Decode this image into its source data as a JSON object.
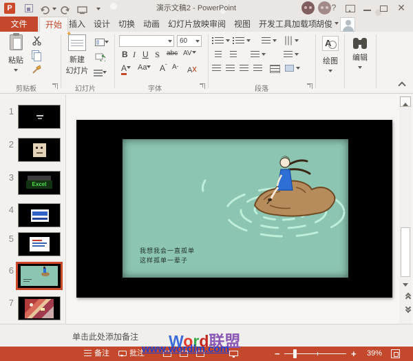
{
  "colors": {
    "accent_red": "#c4482b",
    "active_tab_text": "#c4482b",
    "slide_teal": "#8cc5b2",
    "selected_thumb_border": "#cb4a2b",
    "watermark_url_color": "#1f41cc"
  },
  "titlebar": {
    "title": "演示文稿2 - PowerPoint",
    "help": "?"
  },
  "tabs": {
    "file": "文件",
    "items": [
      "开始",
      "插入",
      "设计",
      "切换",
      "动画",
      "幻灯片放映",
      "审阅",
      "视图",
      "开发工具",
      "加载项"
    ],
    "active": "开始",
    "user": "胡俊"
  },
  "ribbon": {
    "clipboard": {
      "group": "剪贴板",
      "paste": "粘贴"
    },
    "slides": {
      "group": "幻灯片",
      "new_slide_line1": "新建",
      "new_slide_line2": "幻灯片"
    },
    "font": {
      "group": "字体",
      "font_name": "",
      "font_size": "60",
      "bold": "B",
      "italic": "I",
      "underline": "U",
      "shadow": "S",
      "strike": "abc",
      "spacing": "AV",
      "color": "A",
      "case": "Aa"
    },
    "paragraph": {
      "group": "段落"
    },
    "drawing": {
      "group": "绘图"
    },
    "editing": {
      "group": "编辑"
    }
  },
  "thumbnails": {
    "numbers": [
      "1",
      "2",
      "3",
      "4",
      "5",
      "6",
      "7"
    ],
    "selected": "6"
  },
  "slide": {
    "caption_line1": "我想我会一直孤单",
    "caption_line2": "这样孤单一辈子"
  },
  "notes": {
    "placeholder": "单击此处添加备注"
  },
  "watermark": {
    "letters": [
      {
        "t": "W",
        "c": "#3a6bd8"
      },
      {
        "t": "o",
        "c": "#e23b2e"
      },
      {
        "t": "r",
        "c": "#35a94a"
      },
      {
        "t": "d",
        "c": "#c3271e"
      },
      {
        "t": "联盟",
        "c": "#8a57b5"
      }
    ],
    "url": "www.wordlm.com"
  },
  "statusbar": {
    "notes": "备注",
    "comments": "批注",
    "zoom_level": "39%"
  }
}
